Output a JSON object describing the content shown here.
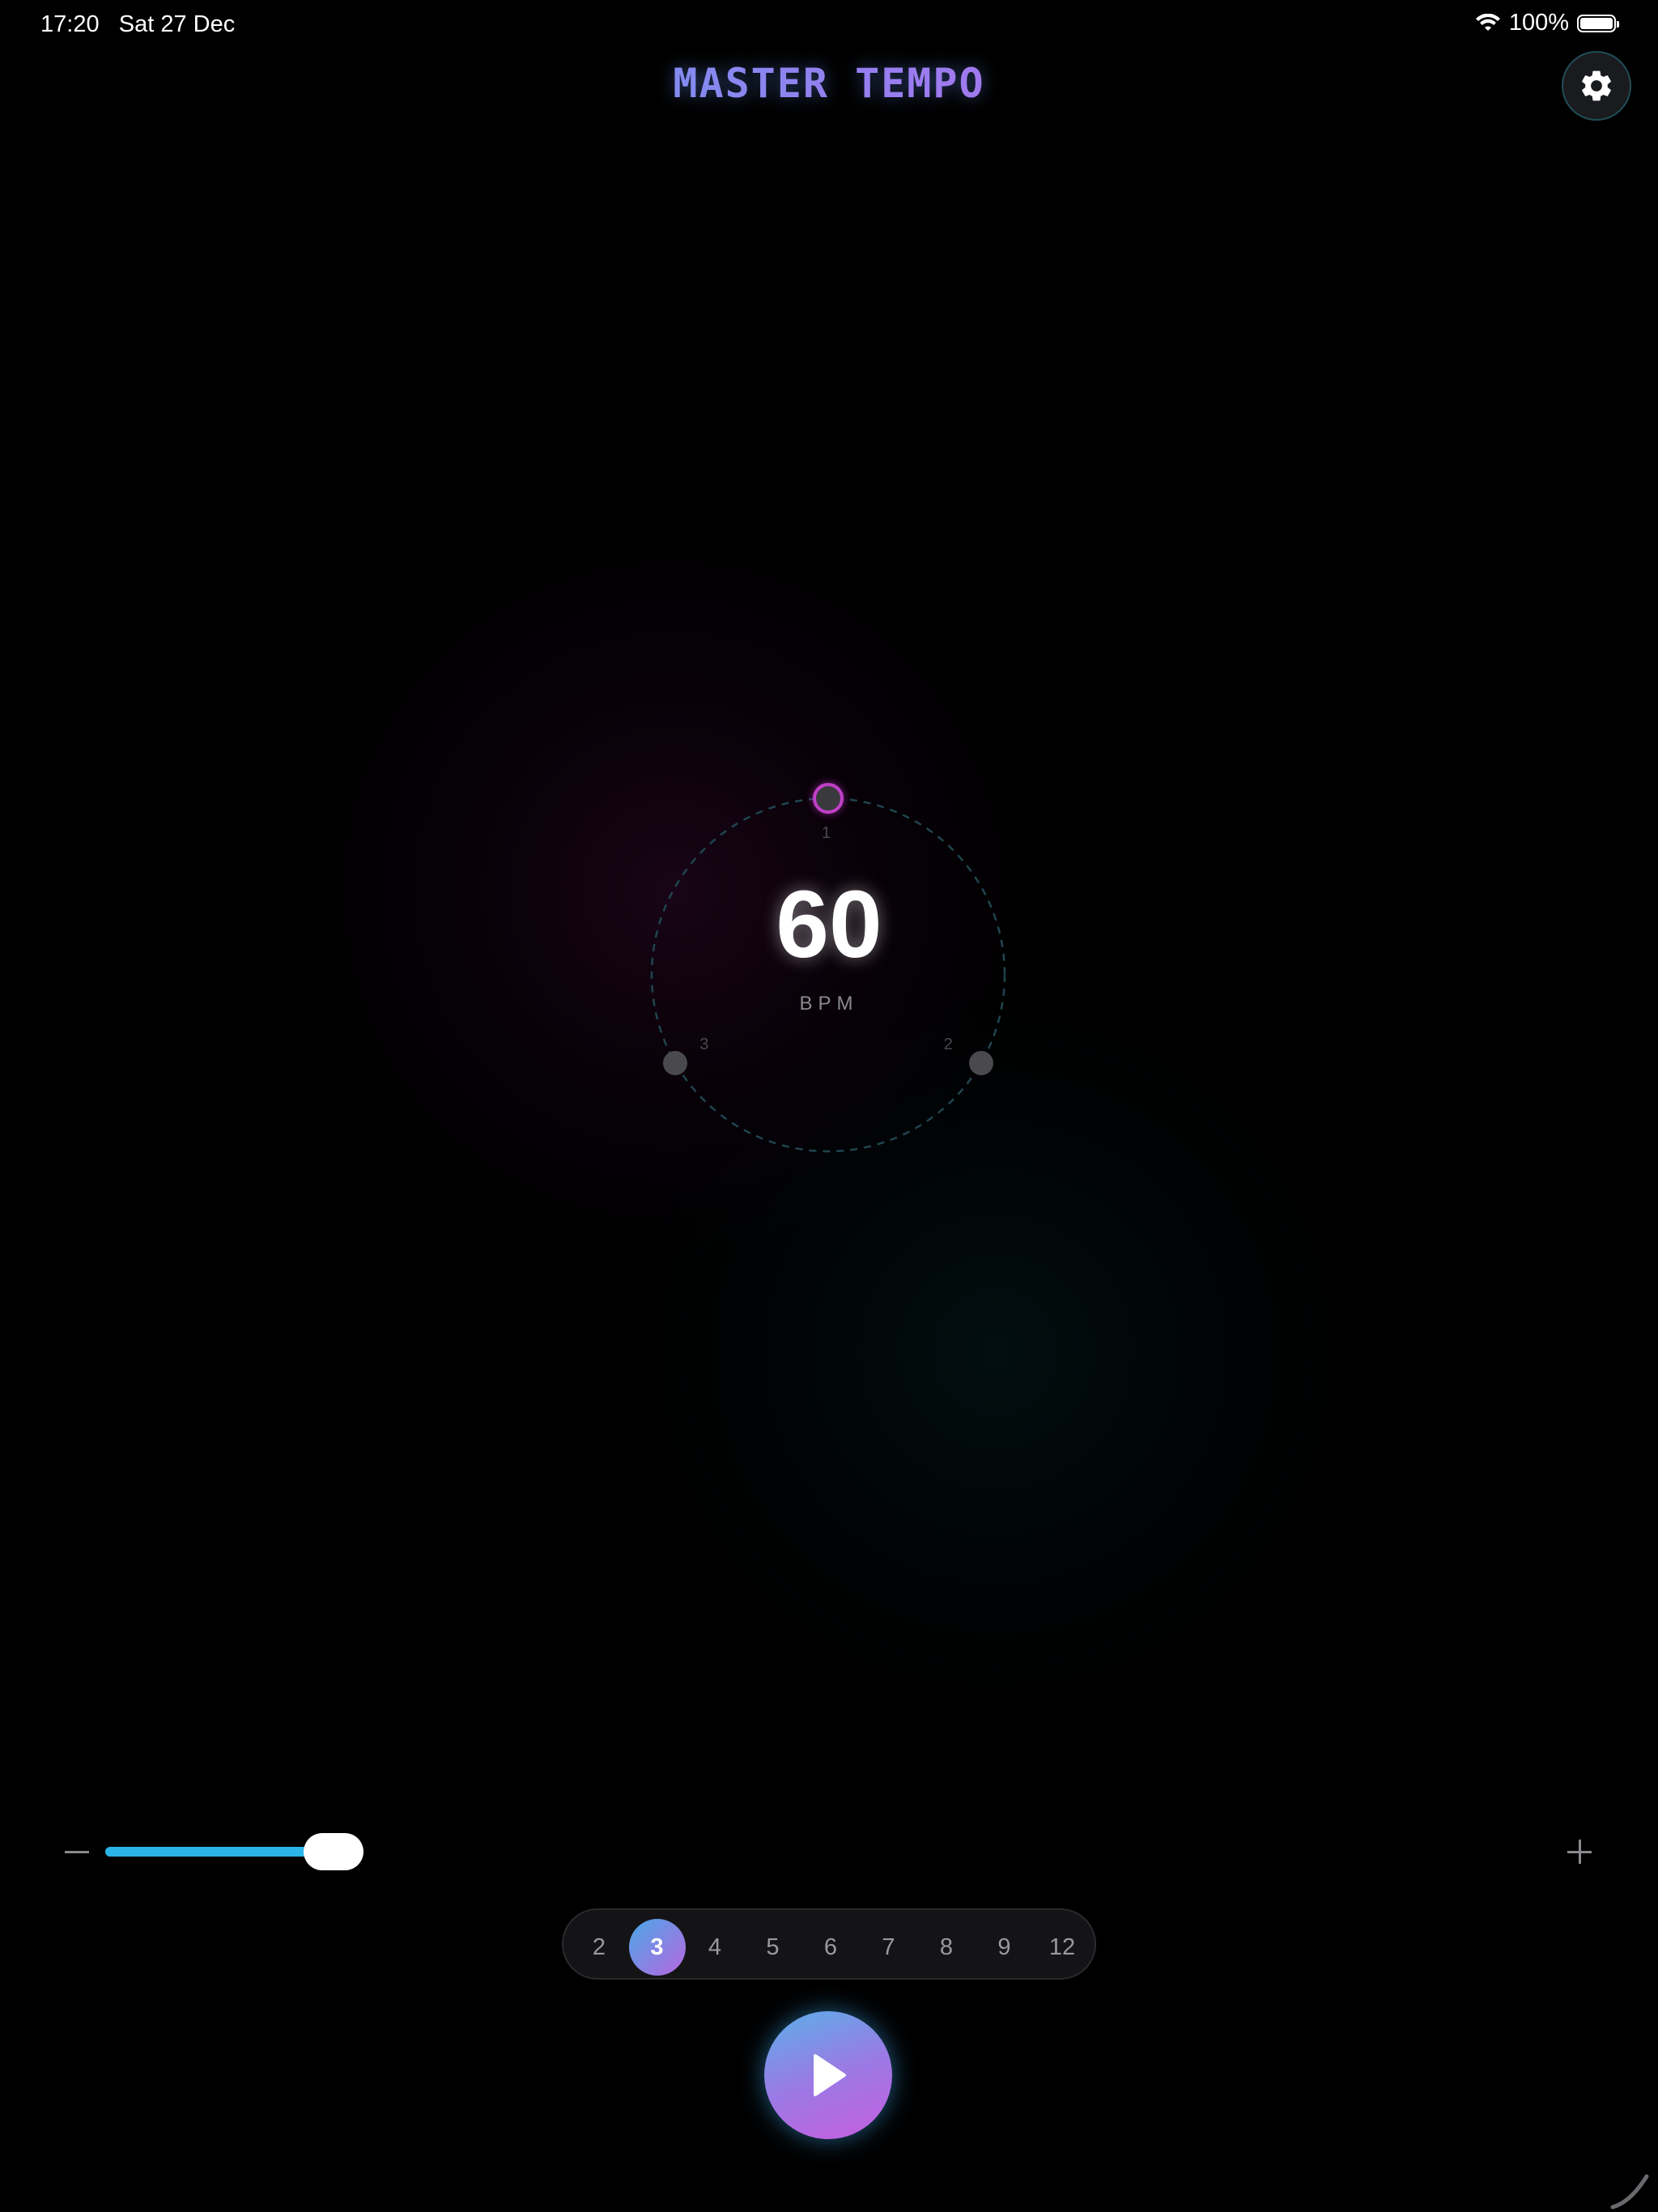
{
  "status_bar": {
    "time": "17:20",
    "date": "Sat 27 Dec",
    "battery": "100%",
    "icons": [
      "wifi-icon",
      "battery-icon"
    ]
  },
  "app": {
    "title": "MASTER TEMPO",
    "settings_icon": "gear-icon"
  },
  "tempo": {
    "bpm": "60",
    "unit": "BPM"
  },
  "beat_dial": {
    "beat_count": 3,
    "active_beat": 1,
    "labels": [
      "1",
      "2",
      "3"
    ]
  },
  "volume": {
    "minus_icon": "minus-icon",
    "plus_icon": "plus-icon",
    "level": 0.9
  },
  "time_signature": {
    "options": [
      "2",
      "3",
      "4",
      "5",
      "6",
      "7",
      "8",
      "9",
      "12"
    ],
    "selected": "3"
  },
  "play": {
    "icon": "play-icon"
  },
  "colors": {
    "accent_blue": "#2bb5e6",
    "accent_magenta": "#c75ee0",
    "background": "#000000"
  }
}
